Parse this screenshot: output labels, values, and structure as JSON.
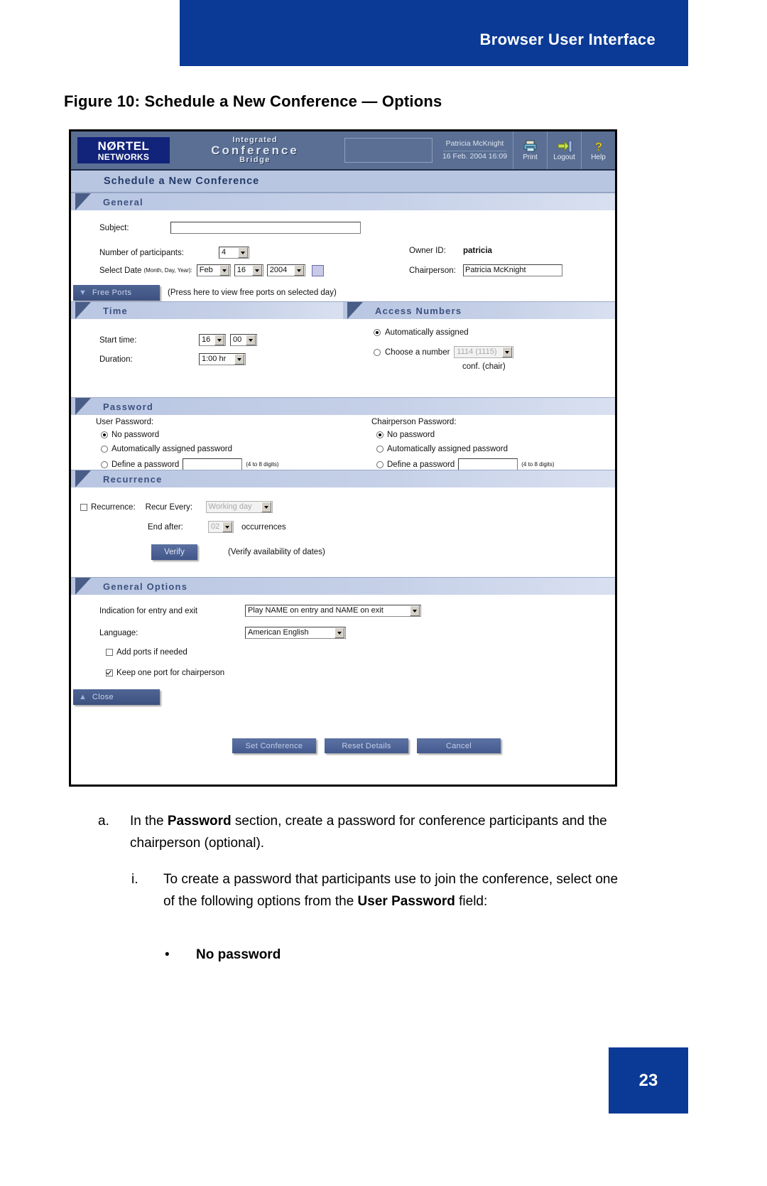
{
  "page": {
    "running_head": "Browser User Interface",
    "figure_caption": "Figure 10: Schedule a New Conference — Options",
    "page_number": "23"
  },
  "app": {
    "logo_line1": "NØRTEL",
    "logo_line2": "NETWORKS",
    "product_line1": "Integrated",
    "product_line2": "Conference",
    "product_line3": "Bridge",
    "user_name": "Patricia McKnight",
    "timestamp": "16 Feb. 2004 16:09",
    "tools": [
      {
        "label": "Print",
        "icon": "printer-icon"
      },
      {
        "label": "Logout",
        "icon": "logout-icon"
      },
      {
        "label": "Help",
        "icon": "help-icon"
      }
    ],
    "page_title": "Schedule a New Conference"
  },
  "general": {
    "heading": "General",
    "subject_label": "Subject:",
    "subject_value": "",
    "participants_label": "Number of participants:",
    "participants_value": "4",
    "select_date_label": "Select Date",
    "select_date_hint": "(Month, Day, Year):",
    "month_value": "Feb",
    "day_value": "16",
    "year_value": "2004",
    "owner_id_label": "Owner ID:",
    "owner_id_value": "patricia",
    "chairperson_label": "Chairperson:",
    "chairperson_value": "Patricia McKnight",
    "free_ports_button": "Free Ports",
    "free_ports_hint": "(Press here to view free ports on selected day)"
  },
  "time": {
    "heading": "Time",
    "start_time_label": "Start time:",
    "start_hour": "16",
    "start_minute": "00",
    "duration_label": "Duration:",
    "duration_value": "1:00 hr"
  },
  "access_numbers": {
    "heading": "Access Numbers",
    "auto_label": "Automatically assigned",
    "auto_selected": true,
    "choose_label": "Choose a number",
    "choose_value": "1114 (1115)",
    "choose_selected": false,
    "sub_label": "conf. (chair)"
  },
  "password": {
    "heading": "Password",
    "user_title": "User Password:",
    "chair_title": "Chairperson Password:",
    "opt_no": "No password",
    "opt_auto": "Automatically assigned password",
    "opt_define": "Define a password",
    "digits_hint": "(4 to 8 digits)",
    "user_selected": "No password",
    "chair_selected": "No password",
    "user_define_value": "",
    "chair_define_value": ""
  },
  "recurrence": {
    "heading": "Recurrence",
    "checkbox_label": "Recurrence:",
    "checkbox_checked": false,
    "recur_every_label": "Recur Every:",
    "recur_every_value": "Working day",
    "end_after_label": "End after:",
    "end_after_value": "02",
    "occurrences_label": "occurrences",
    "verify_button": "Verify",
    "verify_hint": "(Verify availability of dates)"
  },
  "general_options": {
    "heading": "General Options",
    "indication_label": "Indication for entry and exit",
    "indication_value": "Play NAME on entry and NAME on exit",
    "language_label": "Language:",
    "language_value": "American English",
    "add_ports_label": "Add ports if needed",
    "add_ports_checked": false,
    "keep_port_label": "Keep one port for chairperson",
    "keep_port_checked": true,
    "close_button": "Close"
  },
  "footer_buttons": {
    "set_conference": "Set Conference",
    "reset_details": "Reset Details",
    "cancel": "Cancel"
  },
  "instructions": {
    "a_marker": "a.",
    "a_text_1": "In the ",
    "a_bold_1": "Password",
    "a_text_2": " section, create a password for conference participants and the chairperson (optional).",
    "i_marker": "i.",
    "i_text_1": "To create a password that participants use to join the conference, select one of the following options from the ",
    "i_bold_1": "User Password",
    "i_text_2": " field:",
    "bullet_marker": "•",
    "bullet_text": "No password"
  },
  "colors": {
    "brand_blue": "#0a3a96",
    "app_header": "#5a6f93",
    "section_bar": "#b9c6e2",
    "section_text": "#3c5180",
    "button_blue": "#4a5d86"
  }
}
